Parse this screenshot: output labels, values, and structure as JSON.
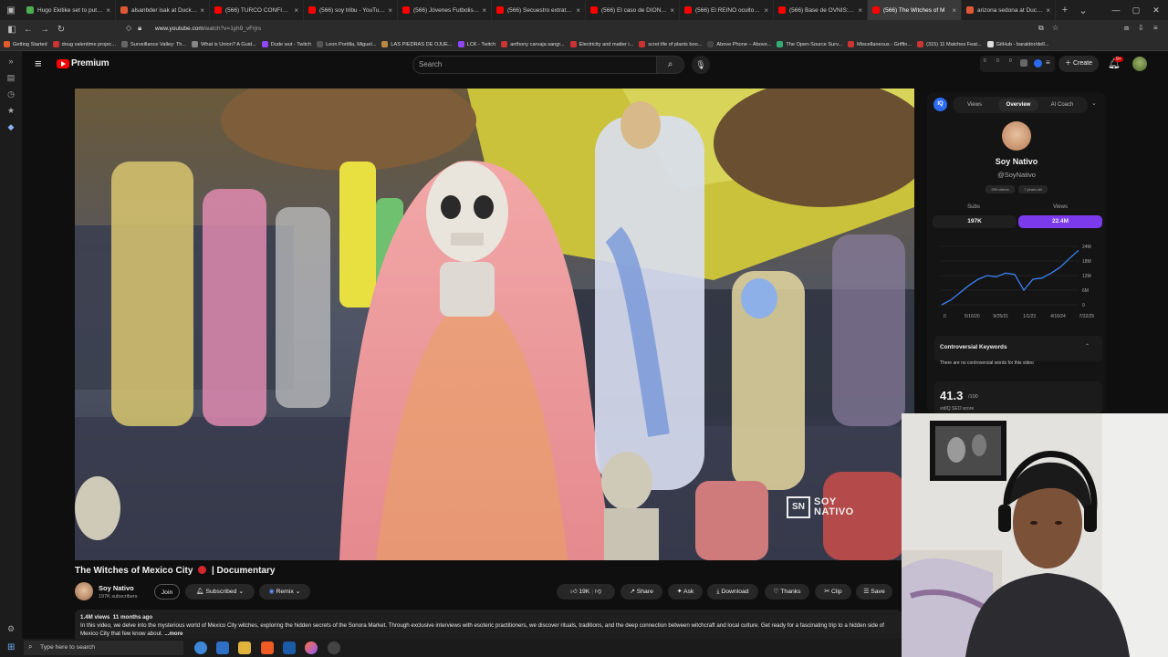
{
  "browser": {
    "tabs": [
      {
        "title": "Hugo Ekitike set to put finish",
        "color": "#4caf50"
      },
      {
        "title": "alsanbder isak at DuckDuckGo",
        "color": "#de5833"
      },
      {
        "title": "(566) TURCO CONFIRMA M",
        "color": "#ff0000"
      },
      {
        "title": "(566) soy tribu - YouTube",
        "color": "#ff0000"
      },
      {
        "title": "(566) Jóvenes Futbolistas M",
        "color": "#ff0000"
      },
      {
        "title": "(566) Secuestro extraterres",
        "color": "#ff0000"
      },
      {
        "title": "(566) El caso de DIONISIO I",
        "color": "#ff0000"
      },
      {
        "title": "(566) El REINO oculto Bajo",
        "color": "#ff0000"
      },
      {
        "title": "(566) Base de OVNIS: El Mis",
        "color": "#ff0000"
      },
      {
        "title": "(566) The Witches of M",
        "color": "#ff0000",
        "active": true
      },
      {
        "title": "arizona sedona at DuckDuckGo",
        "color": "#de5833"
      }
    ],
    "url_host": "www.youtube.com",
    "url_path": "/watch?v=1yh9_vFrjrs",
    "bookmarks": [
      "Getting Started",
      "doug valentime projec...",
      "Surveillance Valley: Th...",
      "What is Union? A Guid...",
      "Dude wut - Twitch",
      "Leon Portilla, Miguel...",
      "LAS PIEDRAS DE OJUE...",
      "LCK - Twitch",
      "anthony carvaja sangr...",
      "Electricity and matter i...",
      "scret life of plants boo...",
      "Above Phone – Above...",
      "The Open-Source Surv...",
      "Miscellaneous - Griffin...",
      "(315) 11 Matches Feat...",
      "GitHub - baraldor/dell..."
    ]
  },
  "youtube": {
    "logo_text": "Premium",
    "search_placeholder": "Search",
    "create_label": "Create",
    "notif_count": "9+"
  },
  "video": {
    "watermark": "SOY NATIVO",
    "title": "The Witches of Mexico City",
    "title_suffix": "| Documentary",
    "channel_name": "Soy Nativo",
    "subscribers": "197K subscribers",
    "join_label": "Join",
    "subscribed_label": "Subscribed",
    "remix_label": "Remix",
    "likes": "19K",
    "share_label": "Share",
    "ask_label": "Ask",
    "download_label": "Download",
    "thanks_label": "Thanks",
    "clip_label": "Clip",
    "save_label": "Save",
    "views_line": "1.4M views",
    "age_line": "11 months ago",
    "description": "In this video, we delve into the mysterious world of Mexico City witches, exploring the hidden secrets of the Sonora Market. Through exclusive interviews with esoteric practitioners, we discover rituals, traditions, and the deep connection between witchcraft and local culture. Get ready for a fascinating trip to a hidden side of Mexico City that few know about.",
    "more_label": "...more"
  },
  "vidiq": {
    "tabs": [
      "Views",
      "Overview",
      "AI Coach"
    ],
    "channel_name": "Soy Nativo",
    "channel_handle": "@SoyNativo",
    "videos_badge": "259 videos",
    "age_badge": "7 years old",
    "subs_label": "Subs",
    "subs_value": "197K",
    "views_label": "Views",
    "views_value": "22.4M",
    "y_ticks": [
      "24M",
      "18M",
      "12M",
      "6M",
      "0"
    ],
    "x_ticks": [
      "0",
      "5/16/20",
      "9/25/21",
      "1/1/23",
      "4/16/24",
      "7/22/25"
    ],
    "controversial_title": "Controversial Keywords",
    "controversial_text": "There are no controversial words for this video",
    "seo_score": "41.3",
    "seo_max": "/100",
    "seo_label": "vidIQ SEO score"
  },
  "chart_data": {
    "type": "line",
    "x": [
      "0",
      "5/16/20",
      "9/25/21",
      "1/1/23",
      "4/16/24",
      "7/22/25"
    ],
    "ylim": [
      0,
      24000000
    ],
    "y_ticks": [
      "24M",
      "18M",
      "12M",
      "6M",
      "0"
    ],
    "series": [
      {
        "values": [
          0,
          2000000,
          5000000,
          8000000,
          10500000,
          12000000,
          11500000,
          13000000,
          12500000,
          6000000,
          10500000,
          11000000,
          13000000,
          15500000,
          19000000,
          22400000
        ]
      }
    ]
  },
  "taskbar": {
    "search_placeholder": "Type here to search"
  }
}
